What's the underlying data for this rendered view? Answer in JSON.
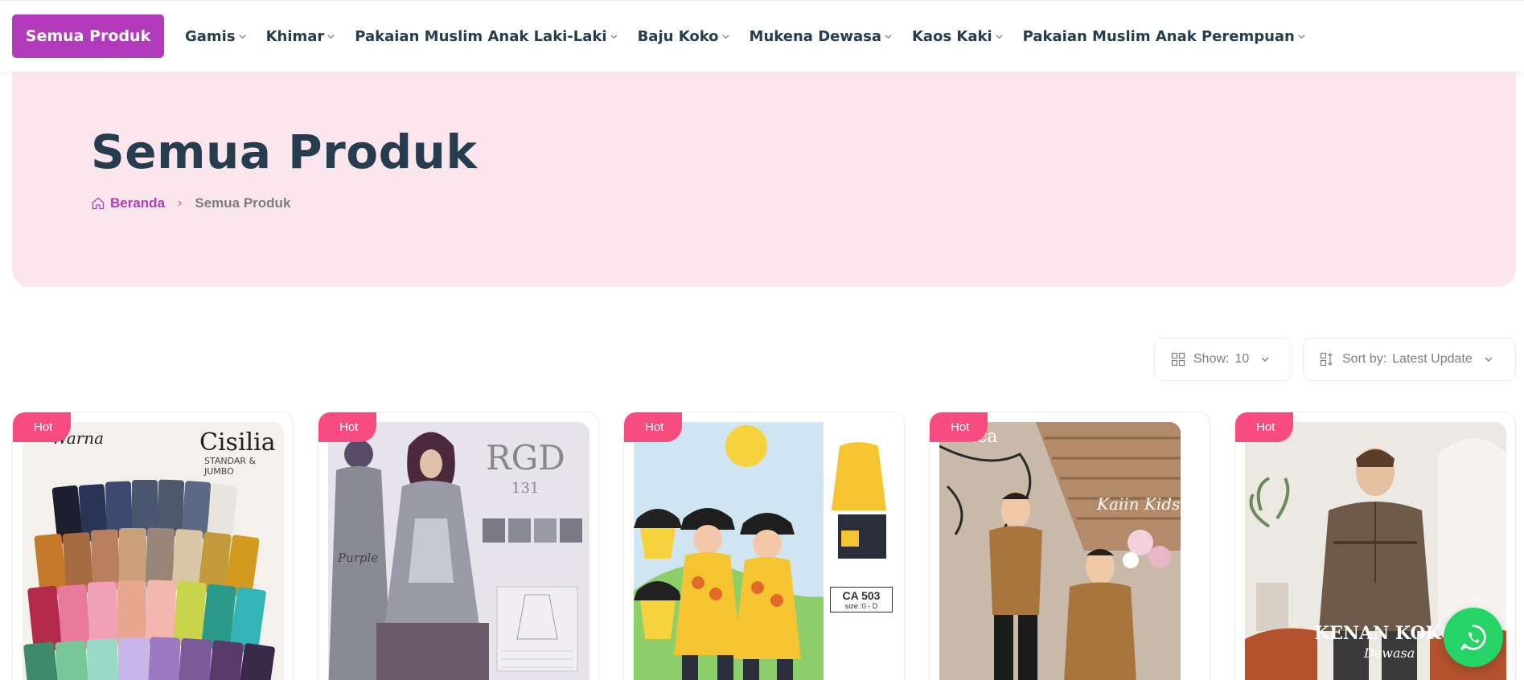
{
  "nav": {
    "all_button": "Semua Produk",
    "items": [
      {
        "label": "Gamis"
      },
      {
        "label": "Khimar"
      },
      {
        "label": "Pakaian Muslim Anak Laki-Laki"
      },
      {
        "label": "Baju Koko"
      },
      {
        "label": "Mukena Dewasa"
      },
      {
        "label": "Kaos Kaki"
      },
      {
        "label": "Pakaian Muslim Anak Perempuan"
      }
    ],
    "chevron_icon": "chevron-down-icon"
  },
  "hero": {
    "title": "Semua Produk",
    "breadcrumb": {
      "home": "Beranda",
      "home_icon": "home-icon",
      "separator": "›",
      "current": "Semua Produk"
    }
  },
  "controls": {
    "show": {
      "label": "Show:",
      "value": "10",
      "icon": "grid-icon"
    },
    "sort": {
      "label": "Sort by:",
      "value": "Latest Update",
      "icon": "sort-icon"
    }
  },
  "products": [
    {
      "badge": "Hot",
      "brand_main": "Cisilia",
      "brand_sub": "STANDAR & JUMBO",
      "brand_left": "Warna"
    },
    {
      "badge": "Hot",
      "brand_main": "RGD",
      "brand_sub": "131",
      "label_left": "Purple"
    },
    {
      "badge": "Hot",
      "tag": "CA 503",
      "tag_sub": "size :0 - D"
    },
    {
      "badge": "Hot",
      "brand_main": "Kaiin Kids",
      "brand_left": "ica"
    },
    {
      "badge": "Hot",
      "brand_main": "KENAN KOKO",
      "brand_sub": "Dewasa"
    }
  ],
  "colors": {
    "primary": "#b23bbb",
    "hero_bg": "#fce6ee",
    "badge": "#f74b81",
    "heading": "#253d4e",
    "whatsapp": "#25d366"
  },
  "whatsapp": {
    "icon": "whatsapp-icon"
  }
}
